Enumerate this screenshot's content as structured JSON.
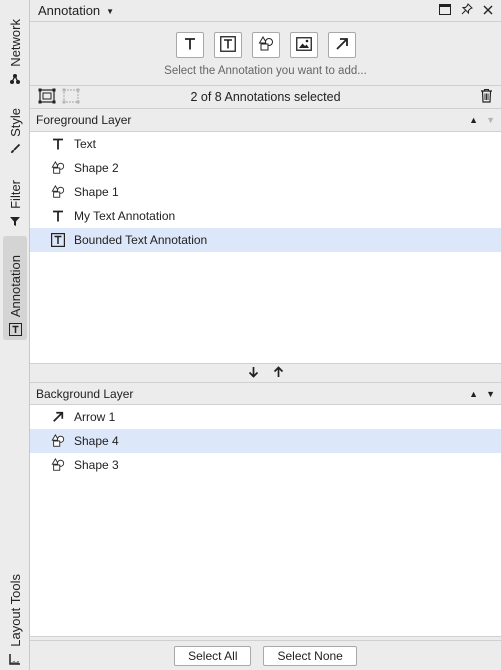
{
  "side_tabs": [
    {
      "label": "Network",
      "icon": "network-icon"
    },
    {
      "label": "Style",
      "icon": "brush-icon"
    },
    {
      "label": "Filter",
      "icon": "filter-icon"
    },
    {
      "label": "Annotation",
      "icon": "annotation-icon",
      "active": true
    },
    {
      "label": "Layout Tools",
      "icon": "ruler-icon"
    }
  ],
  "panel": {
    "title": "Annotation",
    "add_hint": "Select the Annotation you want to add...",
    "selection_status": "2 of 8 Annotations selected"
  },
  "add_buttons": [
    "text-annotation",
    "bounded-text-annotation",
    "shape-annotation",
    "image-annotation",
    "arrow-annotation"
  ],
  "foreground": {
    "header": "Foreground Layer",
    "items": [
      {
        "label": "Text",
        "icon": "text-icon",
        "selected": false
      },
      {
        "label": "Shape 2",
        "icon": "shape-icon",
        "selected": false
      },
      {
        "label": "Shape 1",
        "icon": "shape-icon",
        "selected": false
      },
      {
        "label": "My Text Annotation",
        "icon": "text-icon",
        "selected": false
      },
      {
        "label": "Bounded Text Annotation",
        "icon": "bounded-text-icon",
        "selected": true
      }
    ]
  },
  "background": {
    "header": "Background Layer",
    "items": [
      {
        "label": "Arrow 1",
        "icon": "arrow-icon",
        "selected": false
      },
      {
        "label": "Shape 4",
        "icon": "shape-icon",
        "selected": true
      },
      {
        "label": "Shape 3",
        "icon": "shape-icon",
        "selected": false
      }
    ]
  },
  "buttons": {
    "select_all": "Select All",
    "select_none": "Select None"
  }
}
